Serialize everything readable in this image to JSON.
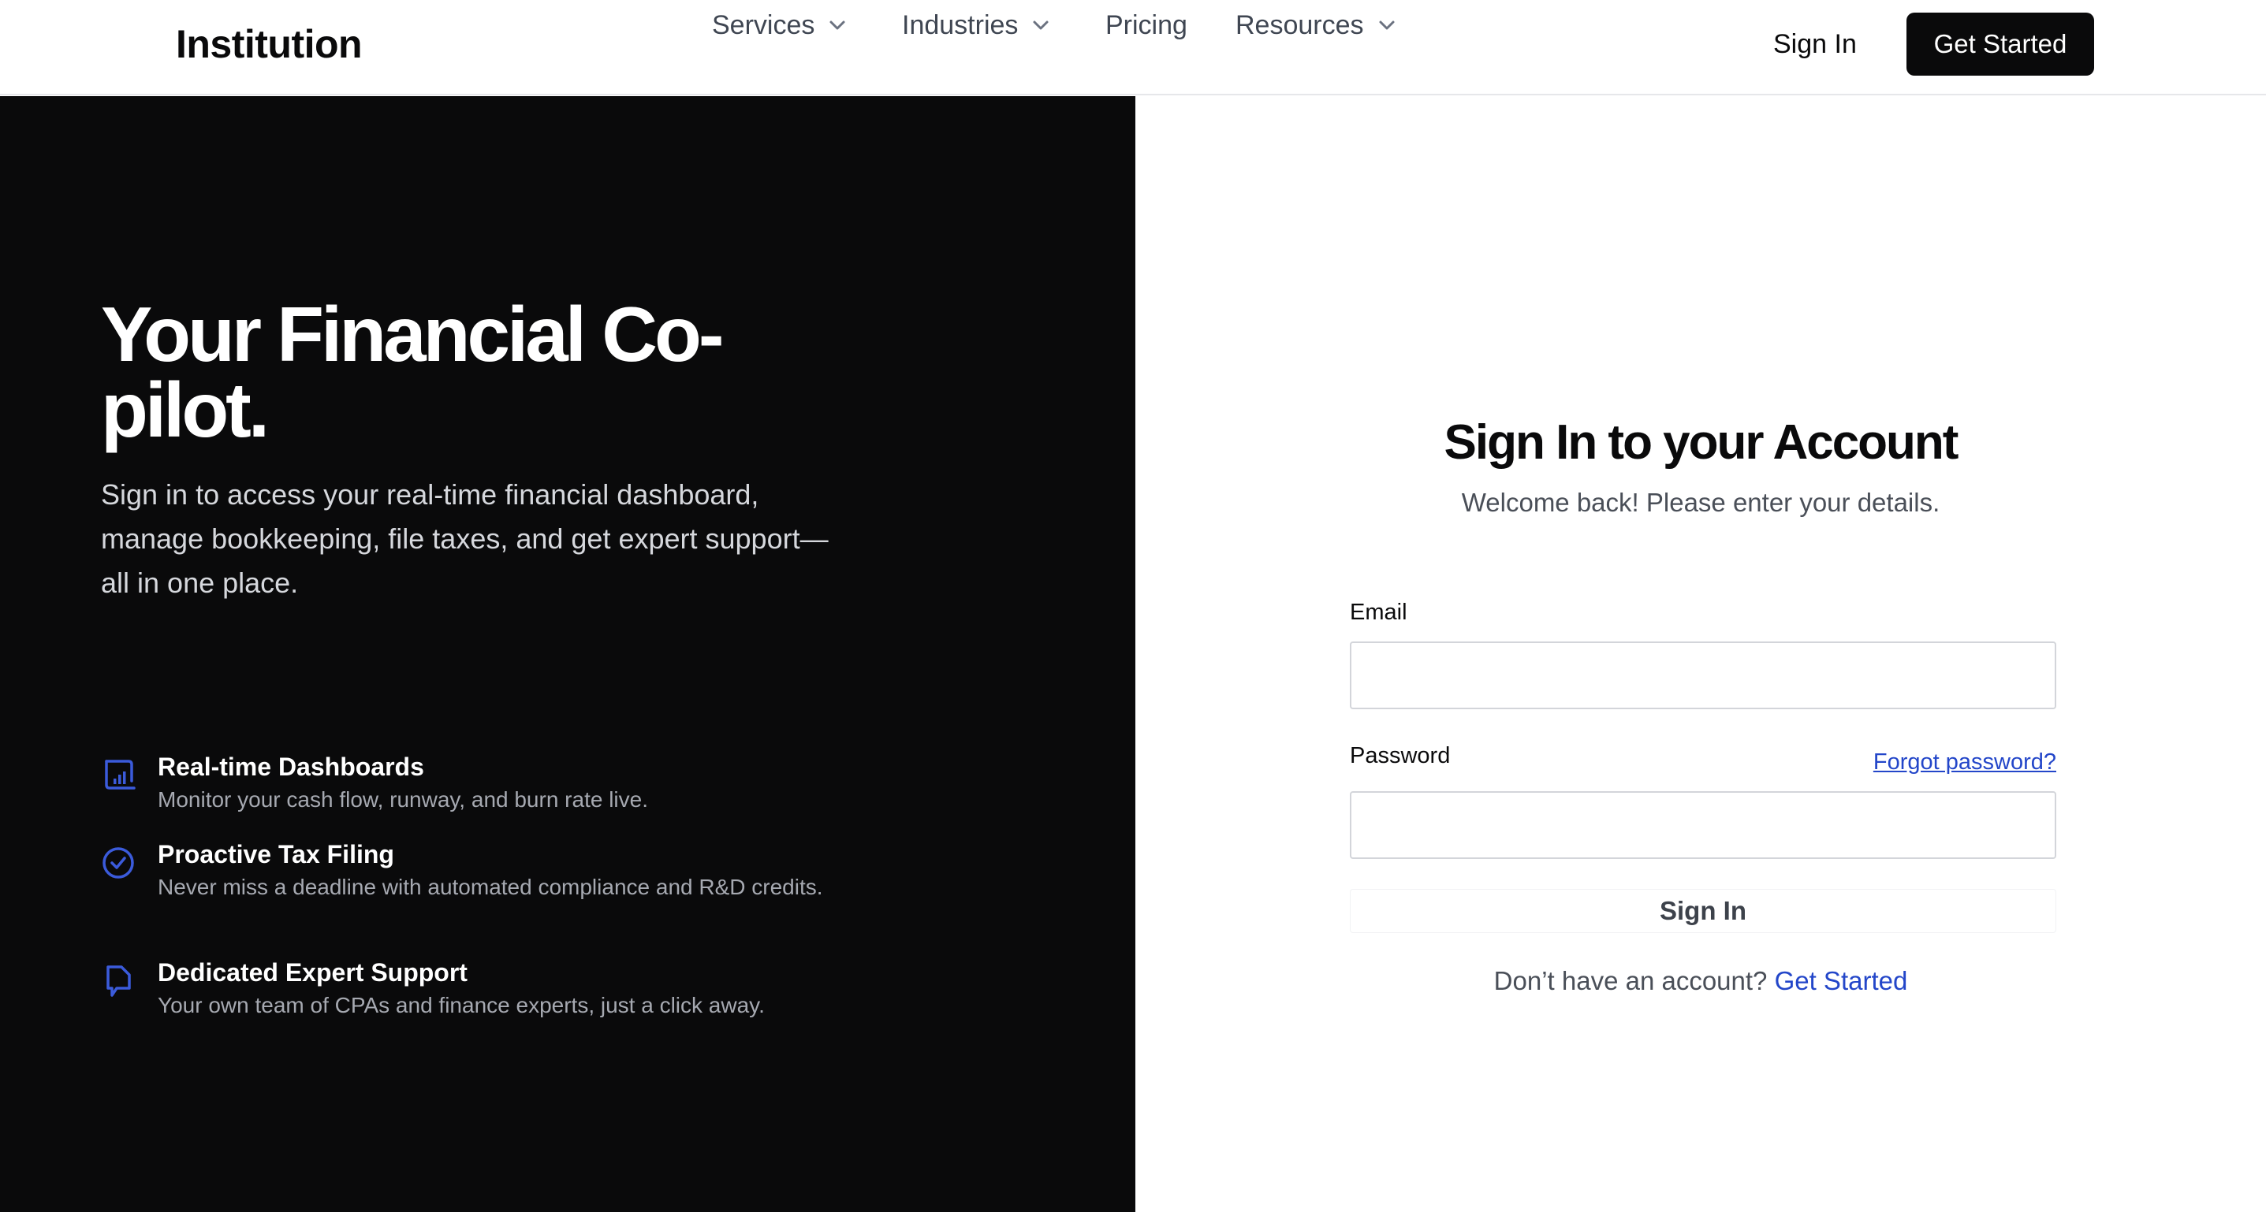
{
  "header": {
    "brand": "Institution",
    "nav": [
      {
        "label": "Services",
        "has_dropdown": true
      },
      {
        "label": "Industries",
        "has_dropdown": true
      },
      {
        "label": "Pricing",
        "has_dropdown": false
      },
      {
        "label": "Resources",
        "has_dropdown": true
      }
    ],
    "sign_in_label": "Sign In",
    "get_started_label": "Get Started"
  },
  "hero": {
    "title": "Your Financial Co-pilot.",
    "subtitle": "Sign in to access your real-time financial dashboard, manage bookkeeping, file taxes, and get expert support—all in one place.",
    "features": [
      {
        "icon": "dashboard-chart-icon",
        "title": "Real-time Dashboards",
        "description": "Monitor your cash flow, runway, and burn rate live."
      },
      {
        "icon": "check-circle-icon",
        "title": "Proactive Tax Filing",
        "description": "Never miss a deadline with automated compliance and R&D credits."
      },
      {
        "icon": "chat-bubble-icon",
        "title": "Dedicated Expert Support",
        "description": "Your own team of CPAs and finance experts, just a click away."
      }
    ]
  },
  "form": {
    "title": "Sign In to your Account",
    "subtitle": "Welcome back! Please enter your details.",
    "email_label": "Email",
    "email_value": "",
    "password_label": "Password",
    "password_value": "",
    "forgot_label": "Forgot password?",
    "submit_label": "Sign In",
    "signup_prompt": "Don’t have an account?",
    "signup_link": "Get Started"
  },
  "colors": {
    "dark_panel": "#0a0a0b",
    "accent_blue": "#2346c9",
    "icon_blue": "#3b5bdb"
  }
}
